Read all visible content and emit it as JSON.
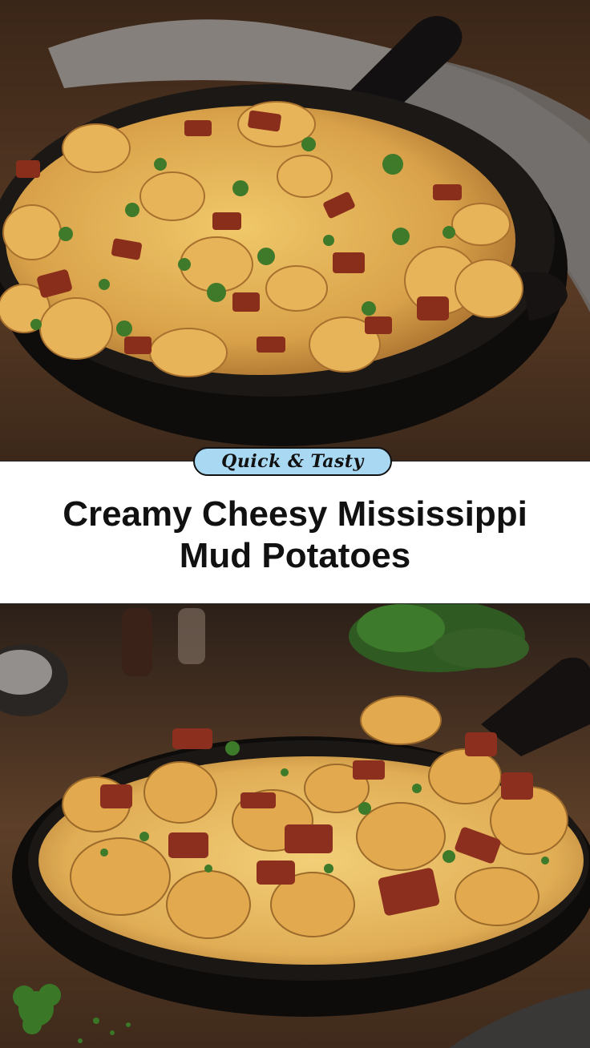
{
  "badge": {
    "label": "Quick & Tasty"
  },
  "title": {
    "text": "Creamy Cheesy Mississippi Mud Potatoes"
  },
  "images": {
    "top": {
      "subject": "cast-iron-skillet-potatoes-top"
    },
    "bottom": {
      "subject": "cast-iron-skillet-potatoes-bottom"
    }
  },
  "colors": {
    "badge_bg": "#a9d8f2",
    "wood": "#5a3a24",
    "skillet": "#151210",
    "cheese": "#e6b95a",
    "bacon": "#8a2e1c",
    "parsley": "#3f7a2a"
  }
}
